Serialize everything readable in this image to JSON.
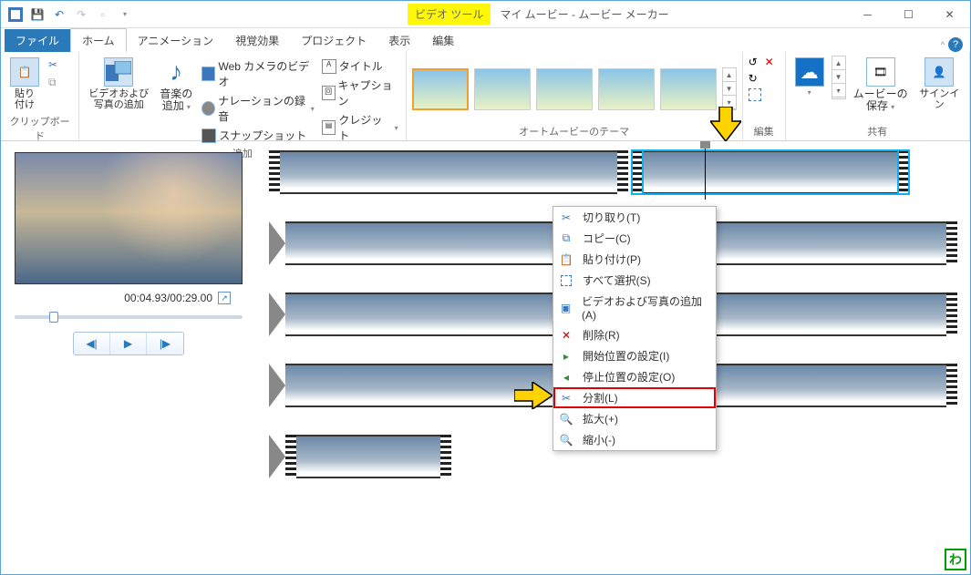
{
  "titlebar": {
    "videoTools": "ビデオ ツール",
    "title": "マイ ムービー - ムービー メーカー"
  },
  "tabs": {
    "file": "ファイル",
    "home": "ホーム",
    "animation": "アニメーション",
    "visual": "視覚効果",
    "project": "プロジェクト",
    "view": "表示",
    "edit": "編集"
  },
  "ribbon": {
    "clipboard": {
      "paste": "貼り\n付け",
      "label": "クリップボード"
    },
    "add": {
      "addMedia": "ビデオおよび\n写真の追加",
      "addMusic": "音楽の\n追加",
      "webcam": "Web カメラのビデオ",
      "narration": "ナレーションの録音",
      "snapshot": "スナップショット",
      "titleBtn": "タイトル",
      "caption": "キャプション",
      "credits": "クレジット",
      "label": "追加"
    },
    "themes": {
      "label": "オートムービーのテーマ"
    },
    "editGroup": {
      "label": "編集"
    },
    "share": {
      "save": "ムービーの\n保存",
      "signin": "サインイン",
      "label": "共有"
    }
  },
  "preview": {
    "time": "00:04.93/00:29.00"
  },
  "contextMenu": {
    "cut": "切り取り(T)",
    "copy": "コピー(C)",
    "paste": "貼り付け(P)",
    "selectAll": "すべて選択(S)",
    "addMedia": "ビデオおよび写真の追加(A)",
    "remove": "削除(R)",
    "setStart": "開始位置の設定(I)",
    "setEnd": "停止位置の設定(O)",
    "split": "分割(L)",
    "zoomIn": "拡大(+)",
    "zoomOut": "縮小(-)"
  }
}
